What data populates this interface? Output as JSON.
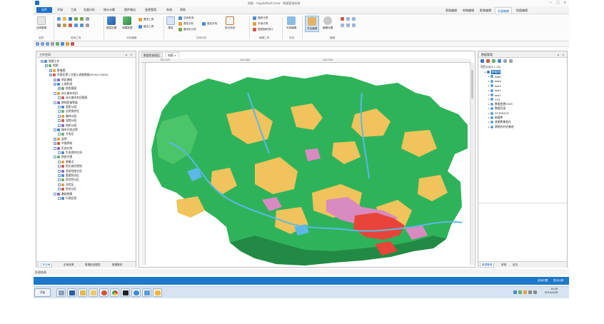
{
  "app": {
    "title": "地图 - mapdefault.smw - 数据管理系统",
    "window_controls": [
      "−",
      "□",
      "×"
    ]
  },
  "menu": {
    "file_tab": "文件",
    "items": [
      "开始",
      "工具",
      "矢量分析",
      "统计计算",
      "图件输出",
      "变更管理",
      "系统",
      "帮助"
    ],
    "context_tabs": [
      "表格编辑",
      "地物编辑",
      "影像编辑",
      "矢量编辑",
      "地图编辑"
    ],
    "active_context_tab": "矢量编辑"
  },
  "ribbon": {
    "buttons": {
      "select": "选择要素",
      "layer_manage": "图层设置",
      "layer_export": "地图数据",
      "overlay_tool": "叠加工具",
      "fusion": "融合工具",
      "erase": "擦除",
      "spatial_query": "空间查询",
      "property_analysis": "属性分析",
      "buffer": "缓冲区分析",
      "add_field": "增加字段",
      "stats_check": "统计检查",
      "area_calc": "面积计算",
      "field_calc": "字段计算",
      "area_stat": "图斑面积统计",
      "finish": "完成编辑",
      "open_edit": "开启编辑",
      "edit_settings": "编辑设置"
    },
    "groups": [
      "选择",
      "常用工具",
      "分析编辑",
      "空间分析",
      "编辑工具",
      "状态",
      "编辑"
    ]
  },
  "left_panel": {
    "title": "工作空间",
    "tree": [
      {
        "level": 0,
        "label": "地图工作",
        "checked": true,
        "expand": "-"
      },
      {
        "level": 1,
        "label": "地图",
        "checked": true,
        "expand": "-"
      },
      {
        "level": 2,
        "label": "影像图",
        "checked": true,
        "expand": ""
      },
      {
        "level": 2,
        "label": "东营区第三次国土调查数据2019(1:5000)",
        "checked": true,
        "expand": "-"
      },
      {
        "level": 3,
        "label": "地区基础",
        "checked": true,
        "expand": ""
      },
      {
        "level": 3,
        "label": "土地利用",
        "checked": true,
        "expand": "-"
      },
      {
        "level": 4,
        "label": "地类图斑",
        "checked": true,
        "expand": ""
      },
      {
        "level": 3,
        "label": "永久基本农田",
        "checked": false,
        "expand": "-"
      },
      {
        "level": 4,
        "label": "永久基本农田图斑",
        "checked": false,
        "expand": ""
      },
      {
        "level": 3,
        "label": "耕地质量等级",
        "checked": false,
        "expand": "-"
      },
      {
        "level": 4,
        "label": "国家公园",
        "checked": false,
        "expand": ""
      },
      {
        "level": 4,
        "label": "自然保护区",
        "checked": false,
        "expand": ""
      },
      {
        "level": 4,
        "label": "森林公园",
        "checked": false,
        "expand": ""
      },
      {
        "level": 4,
        "label": "湿地公园",
        "checked": false,
        "expand": ""
      },
      {
        "level": 4,
        "label": "地质公园",
        "checked": false,
        "expand": ""
      },
      {
        "level": 3,
        "label": "城市开发边界",
        "checked": false,
        "expand": "-"
      },
      {
        "level": 4,
        "label": "开发区",
        "checked": false,
        "expand": ""
      },
      {
        "level": 3,
        "label": "县界",
        "checked": true,
        "expand": ""
      },
      {
        "level": 3,
        "label": "乡镇界线",
        "checked": true,
        "expand": ""
      },
      {
        "level": 3,
        "label": "生态红线",
        "checked": false,
        "expand": "-"
      },
      {
        "level": 4,
        "label": "生态保护红线",
        "checked": false,
        "expand": ""
      },
      {
        "level": 3,
        "label": "地质灾害",
        "checked": false,
        "expand": "-"
      },
      {
        "level": 4,
        "label": "隐患点",
        "checked": false,
        "expand": ""
      },
      {
        "level": 4,
        "label": "防灾减灾规划",
        "checked": false,
        "expand": ""
      },
      {
        "level": 4,
        "label": "易发程度分区",
        "checked": false,
        "expand": ""
      },
      {
        "level": 4,
        "label": "重要防治区",
        "checked": false,
        "expand": ""
      },
      {
        "level": 4,
        "label": "危险性分区",
        "checked": false,
        "expand": ""
      },
      {
        "level": 4,
        "label": "风险区",
        "checked": false,
        "expand": ""
      },
      {
        "level": 4,
        "label": "防治分区",
        "checked": false,
        "expand": ""
      },
      {
        "level": 3,
        "label": "基础地理",
        "checked": false,
        "expand": "-"
      },
      {
        "level": 4,
        "label": "行政区划",
        "checked": false,
        "expand": ""
      }
    ],
    "bottom_tabs": [
      "工作空间",
      "实体资源",
      "数据检查图层",
      "数据服务"
    ]
  },
  "map": {
    "tabs": [
      "数据检查图层",
      "地图"
    ],
    "active_tab": "地图",
    "ruler_labels": [
      "120.229",
      "120.282",
      "120.335"
    ]
  },
  "right_panel": {
    "title": "数据管理",
    "root": "项目(DB3.1.13)",
    "items": [
      {
        "level": 1,
        "label": "数据库"
      },
      {
        "level": 2,
        "label": "ww5"
      },
      {
        "level": 2,
        "label": "ww4"
      },
      {
        "level": 2,
        "label": "ww3"
      },
      {
        "level": 2,
        "label": "ww1"
      },
      {
        "level": 2,
        "label": "ww7"
      },
      {
        "level": 2,
        "label": "123"
      },
      {
        "level": 2,
        "label": "数据变更0419"
      },
      {
        "level": 2,
        "label": "数据目录"
      },
      {
        "level": 2,
        "label": "20190419"
      },
      {
        "level": 2,
        "label": "新建库"
      },
      {
        "level": 2,
        "label": "遥感影像变化"
      },
      {
        "level": 2,
        "label": "耕地农村宅基地"
      }
    ],
    "bottom_tabs": [
      "数据管理",
      "资源",
      "定位"
    ]
  },
  "status": {
    "label": "处理结果"
  },
  "bluebar": {
    "left": "",
    "right_items": [
      "坐标位置",
      "显示比例"
    ]
  },
  "taskbar": {
    "start": "开始",
    "tray_time": "14:35",
    "tray_date": "2019/4/26"
  },
  "colors": {
    "accent": "#1e6fc2",
    "map_green": "#2fb35a",
    "map_yellow": "#f0c35c",
    "map_red": "#e8443a",
    "map_pink": "#d98ac0",
    "map_blue": "#5bb8e8"
  }
}
